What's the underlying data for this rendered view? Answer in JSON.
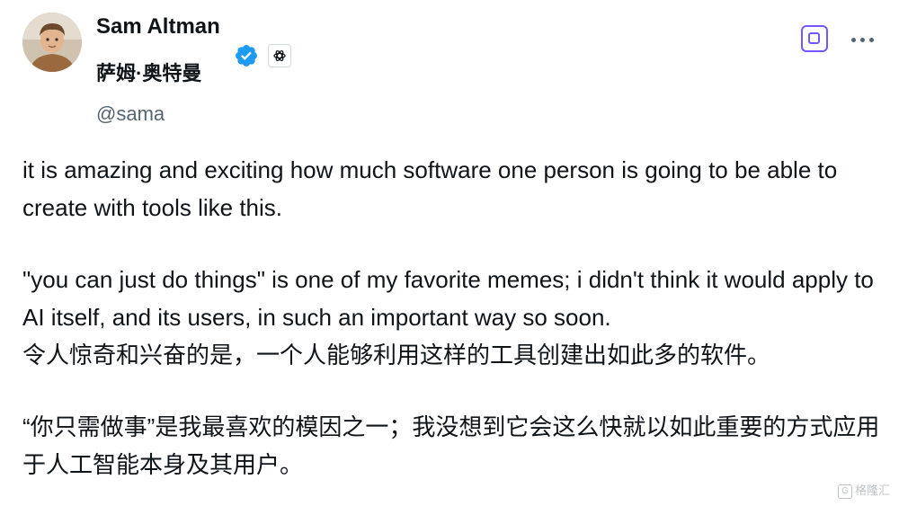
{
  "author": {
    "display_name": "Sam Altman",
    "display_name_cn": "萨姆·奥特曼",
    "handle": "@sama",
    "avatar_icon": "user-avatar",
    "verified_icon": "verified-badge-icon",
    "affiliate_icon": "openai-logo-icon"
  },
  "actions": {
    "grok_icon": "grok-icon",
    "more_icon": "more-options-icon"
  },
  "post": {
    "paragraphs_en": [
      "it is amazing and exciting how much software one person is going to be able to create with tools like this.",
      "\"you can just do things\" is one of my favorite memes; i didn't think it would apply to AI itself, and its users, in such an important way so soon."
    ],
    "paragraphs_cn": [
      "令人惊奇和兴奋的是，一个人能够利用这样的工具创建出如此多的软件。",
      "“你只需做事”是我最喜欢的模因之一；我没想到它会这么快就以如此重要的方式应用于人工智能本身及其用户。"
    ]
  },
  "watermark": {
    "label": "格隆汇",
    "mark": "G"
  },
  "colors": {
    "text": "#0f1419",
    "secondary_text": "#536471",
    "verified_blue": "#1d9bf0",
    "grok_purple": "#7856ff",
    "border": "#cfd9de"
  }
}
